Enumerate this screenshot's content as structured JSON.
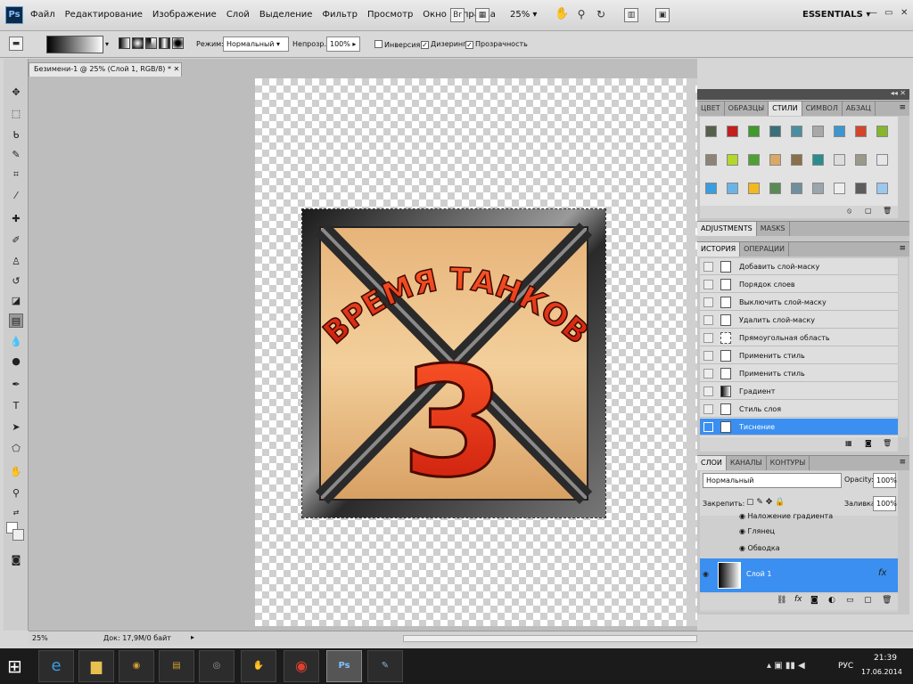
{
  "app": {
    "logo": "Ps"
  },
  "menu": [
    "Файл",
    "Редактирование",
    "Изображение",
    "Слой",
    "Выделение",
    "Фильтр",
    "Просмотр",
    "Окно",
    "Справка"
  ],
  "appbar": {
    "zoom": "25%",
    "workspace": "ESSENTIALS"
  },
  "options": {
    "mode_label": "Режим:",
    "mode_value": "Нормальный",
    "opacity_label": "Непрозр.:",
    "opacity_value": "100%",
    "invert_label": "Инверсия",
    "dither_label": "Дизеринг",
    "transparency_label": "Прозрачность"
  },
  "document": {
    "tab_title": "Безимени-1 @ 25% (Слой 1, RGB/8) *",
    "artwork_title": "ВРЕМЯ ТАНКОВ",
    "artwork_number": "3"
  },
  "status": {
    "zoom": "25%",
    "doc_info": "Док: 17,9M/0 байт"
  },
  "color_panel": {
    "tabs": [
      "ЦВЕТ",
      "ОБРАЗЦЫ",
      "СТИЛИ",
      "СИМВОЛ",
      "АБЗАЦ"
    ],
    "active_tab": "СТИЛИ",
    "swatches": [
      "#56614c",
      "#c21f1f",
      "#3d9a2b",
      "#3a6f7a",
      "#4c8ea0",
      "#a8a8a8",
      "#3c97cf",
      "#d3462b",
      "#86b62d",
      "#8c8577",
      "#b3d72a",
      "#4ea033",
      "#d9a766",
      "#8a6f4a",
      "#2a8d8d",
      "#dcdcdc",
      "#9a998a",
      "#e6e6e6",
      "#3a9de0",
      "#6cb4e6",
      "#f2b91f",
      "#5a8a55",
      "#6f8f9c",
      "#9aa5ad",
      "#eeeeee",
      "#5c5c5c",
      "#9cc7ef"
    ]
  },
  "adjust_panel": {
    "tabs": [
      "ADJUSTMENTS",
      "MASKS"
    ]
  },
  "history_panel": {
    "tabs": [
      "ИСТОРИЯ",
      "ОПЕРАЦИИ"
    ],
    "items": [
      "Добавить слой-маску",
      "Порядок слоев",
      "Выключить слой-маску",
      "Удалить слой-маску",
      "Прямоугольная область",
      "Применить стиль",
      "Применить стиль",
      "Градиент",
      "Стиль слоя",
      "Тиснение"
    ]
  },
  "layers_panel": {
    "tabs": [
      "СЛОИ",
      "КАНАЛЫ",
      "КОНТУРЫ"
    ],
    "blend_mode": "Нормальный",
    "opacity_label": "Opacity:",
    "opacity_value": "100%",
    "lock_label": "Закрепить:",
    "fill_label": "Заливка:",
    "fill_value": "100%",
    "effects": [
      "Наложение градиента",
      "Глянец",
      "Обводка"
    ],
    "layer_name": "Слой 1",
    "fx": "fx"
  },
  "taskbar": {
    "language": "РУС",
    "time": "21:39",
    "date": "17.06.2014"
  }
}
